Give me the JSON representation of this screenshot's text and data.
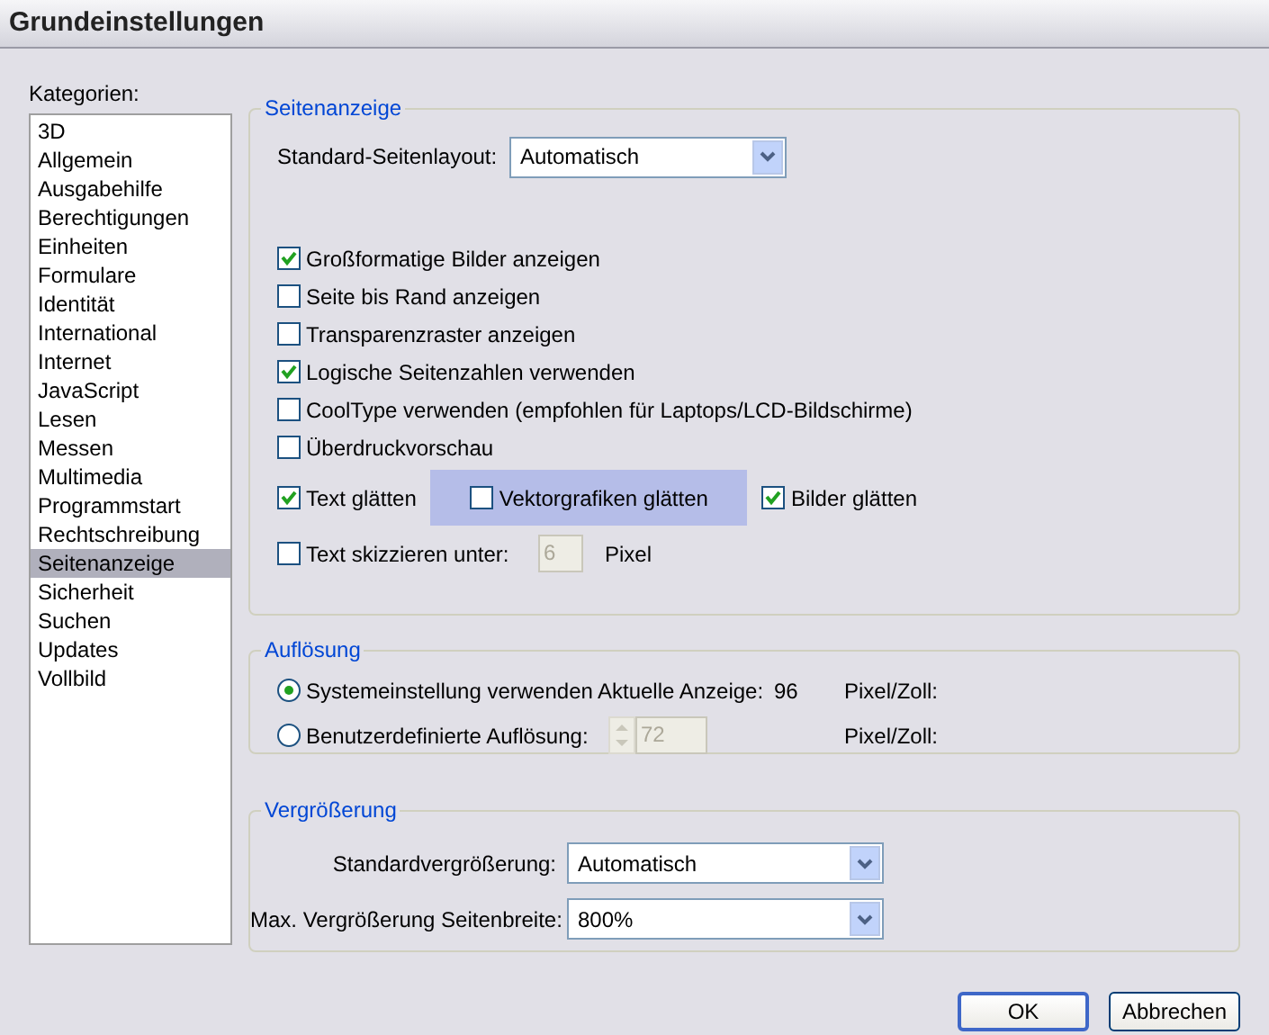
{
  "window": {
    "title": "Grundeinstellungen"
  },
  "sidebar": {
    "label": "Kategorien:",
    "items": [
      {
        "label": "3D",
        "selected": false
      },
      {
        "label": "Allgemein",
        "selected": false
      },
      {
        "label": "Ausgabehilfe",
        "selected": false
      },
      {
        "label": "Berechtigungen",
        "selected": false
      },
      {
        "label": "Einheiten",
        "selected": false
      },
      {
        "label": "Formulare",
        "selected": false
      },
      {
        "label": "Identität",
        "selected": false
      },
      {
        "label": "International",
        "selected": false
      },
      {
        "label": "Internet",
        "selected": false
      },
      {
        "label": "JavaScript",
        "selected": false
      },
      {
        "label": "Lesen",
        "selected": false
      },
      {
        "label": "Messen",
        "selected": false
      },
      {
        "label": "Multimedia",
        "selected": false
      },
      {
        "label": "Programmstart",
        "selected": false
      },
      {
        "label": "Rechtschreibung",
        "selected": false
      },
      {
        "label": "Seitenanzeige",
        "selected": true
      },
      {
        "label": "Sicherheit",
        "selected": false
      },
      {
        "label": "Suchen",
        "selected": false
      },
      {
        "label": "Updates",
        "selected": false
      },
      {
        "label": "Vollbild",
        "selected": false
      }
    ]
  },
  "page_display": {
    "title": "Seitenanzeige",
    "layout_label": "Standard-Seitenlayout:",
    "layout_value": "Automatisch",
    "rows": [
      {
        "kind": "single",
        "items": [
          {
            "label": "Großformatige Bilder anzeigen",
            "checked": true,
            "highlighted": false
          }
        ]
      },
      {
        "kind": "single",
        "items": [
          {
            "label": "Seite bis Rand anzeigen",
            "checked": false,
            "highlighted": false
          }
        ]
      },
      {
        "kind": "single",
        "items": [
          {
            "label": "Transparenzraster anzeigen",
            "checked": false,
            "highlighted": false
          }
        ]
      },
      {
        "kind": "single",
        "items": [
          {
            "label": "Logische Seitenzahlen verwenden",
            "checked": true,
            "highlighted": false
          }
        ]
      },
      {
        "kind": "single",
        "items": [
          {
            "label": "CoolType verwenden (empfohlen für Laptops/LCD-Bildschirme)",
            "checked": false,
            "highlighted": false
          }
        ]
      },
      {
        "kind": "single",
        "items": [
          {
            "label": "Überdruckvorschau",
            "checked": false,
            "highlighted": false
          }
        ]
      },
      {
        "kind": "multi",
        "items": [
          {
            "label": "Text glätten",
            "checked": true,
            "highlighted": false
          },
          {
            "label": "Vektorgrafiken glätten",
            "checked": false,
            "highlighted": true
          },
          {
            "label": "Bilder glätten",
            "checked": true,
            "highlighted": false
          }
        ]
      },
      {
        "kind": "threshold",
        "items": [
          {
            "label": "Text skizzieren unter:",
            "checked": false,
            "highlighted": false
          }
        ],
        "value": "6",
        "unit": "Pixel",
        "disabled": true
      }
    ]
  },
  "resolution": {
    "title": "Auflösung",
    "options": [
      {
        "label": "Systemeinstellung verwenden",
        "selected": true,
        "info_label": "Aktuelle Anzeige:",
        "info_value": "96",
        "unit": "Pixel/Zoll:"
      },
      {
        "label": "Benutzerdefinierte Auflösung:",
        "selected": false,
        "value": "72",
        "disabled": true,
        "unit": "Pixel/Zoll:"
      }
    ]
  },
  "zoom": {
    "title": "Vergrößerung",
    "fields": [
      {
        "label": "Standardvergrößerung:",
        "value": "Automatisch"
      },
      {
        "label": "Max. Vergrößerung Seitenbreite:",
        "value": "800%"
      }
    ]
  },
  "buttons": [
    {
      "label": "OK",
      "default": true
    },
    {
      "label": "Abbrechen",
      "default": false
    }
  ]
}
